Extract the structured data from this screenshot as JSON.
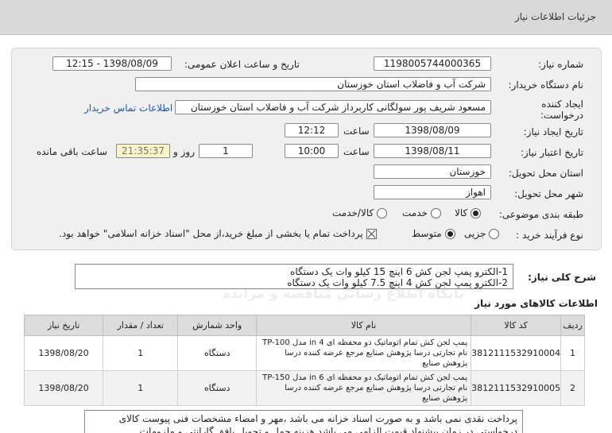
{
  "header": {
    "title": "جزئیات اطلاعات نیاز"
  },
  "form": {
    "need_number_label": "شماره نیاز:",
    "need_number": "1198005744000365",
    "announce_label": "تاریخ و ساعت اعلان عمومی:",
    "announce_value": "1398/08/09 - 12:15",
    "buyer_label": "نام دستگاه خریدار:",
    "buyer_value": "شرکت آب و فاضلاب استان خوزستان",
    "creator_label_1": "ایجاد کننده",
    "creator_label_2": "درخواست:",
    "creator_value": "مسعود شریف پور سولگانی کاربرداز شرکت آب و فاضلاب استان خوزستان",
    "contact_link": "اطلاعات تماس خریدار",
    "created_date_label": "تاریخ ایجاد نیاز:",
    "created_date": "1398/08/09",
    "time_label": "ساعت",
    "created_time": "12:12",
    "validity_label": "تاریخ اعتبار نیاز:",
    "validity_date": "1398/08/11",
    "validity_time": "10:00",
    "days_value": "1",
    "days_label": "روز و",
    "remaining_time": "21:35:37",
    "remaining_label": "ساعت باقی مانده",
    "province_label": "استان محل تحویل:",
    "province_value": "خوزستان",
    "city_label": "شهر محل تحویل:",
    "city_value": "اهواز",
    "category_label": "طبقه بندی موضوعی:",
    "category_options": [
      "کالا",
      "خدمت",
      "کالا/خدمت"
    ],
    "process_label": "نوع فرآیند خرید :",
    "process_options": [
      "جزیی",
      "متوسط"
    ],
    "payment_note": "پرداخت تمام یا بخشی از مبلغ خرید،از محل \"اسناد خزانه اسلامی\" خواهد بود."
  },
  "description": {
    "label": "شرح کلی نیاز:",
    "line1": "1-الکترو پمپ لجن کش 6 اینچ 15 کیلو وات یک دستگاه",
    "line2": "2-الکترو پمپ لجن کش 4 اینچ 7.5 کیلو وات یک دستگاه"
  },
  "items_section": {
    "title": "اطلاعات کالاهای مورد نیاز",
    "headers": [
      "ردیف",
      "کد کالا",
      "نام کالا",
      "واحد شمارش",
      "تعداد / مقدار",
      "تاریخ نیاز"
    ],
    "rows": [
      {
        "row": "1",
        "code": "3812111532910004",
        "name": "پمپ لجن کش تمام اتوماتیک دو محفظه ای in 4 مدل TP-100 نام تجارتی درسا پژوهش صنایع مرجع عرضه کننده درسا پژوهش صنایع",
        "unit": "دستگاه",
        "qty": "1",
        "date": "1398/08/20"
      },
      {
        "row": "2",
        "code": "3812111532910005",
        "name": "پمپ لجن کش تمام اتوماتیک دو محفظه ای in 6 مدل TP-150 نام تجارتی درسا پژوهش صنایع مرجع عرضه کننده درسا پژوهش صنایع",
        "unit": "دستگاه",
        "qty": "1",
        "date": "1398/08/20"
      }
    ]
  },
  "notes": {
    "text": "پرداخت نقدی نمی باشد و به صورت اسناد خزانه می باشد ،مهر و امضاء مشخصات فنی پیوست کالای درخواستی در زمان پیشنهاد قیمت الزامی می باشد هزینه حمل و تحویل بافق گارانتی و ملزومات"
  },
  "watermark": {
    "line1": "ParsNamadData",
    "line2": "پارس نماد داده ها",
    "line3": "پایگاه اطلاع رسانی مناقصه و مزایده",
    "phone": "021-88349670"
  },
  "colors": {
    "header_bg": "#d9d9d9",
    "panel_bg": "#f0f0f0",
    "link": "#1a56c4",
    "remaining_bg": "#f7f4c8"
  }
}
